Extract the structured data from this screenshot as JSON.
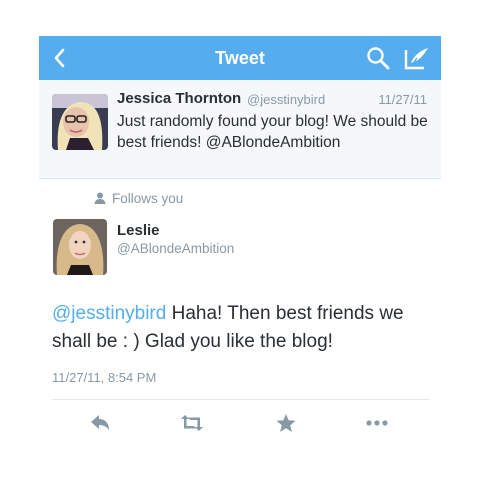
{
  "navbar": {
    "title": "Tweet",
    "back_icon": "chevron-left-icon",
    "search_icon": "search-icon",
    "compose_icon": "compose-icon",
    "background": "#55acee"
  },
  "reply_tweet": {
    "name": "Jessica Thornton",
    "handle": "@jesstinybird",
    "time": "11/27/11",
    "text": "Just randomly found your blog! We should be best friends! @ABlondeAmbition"
  },
  "follows_label": "Follows you",
  "main_tweet": {
    "name": "Leslie",
    "handle": "@ABlondeAmbition",
    "mention": "@jesstinybird",
    "body": " Haha! Then best friends we shall be : ) Glad you like the blog!",
    "timestamp": "11/27/11, 8:54 PM"
  },
  "actions": [
    "reply-icon",
    "retweet-icon",
    "favorite-icon",
    "more-icon"
  ],
  "colors": {
    "accent": "#55acee",
    "text": "#292f33",
    "secondary": "#8899a6",
    "icon": "#8899a6"
  }
}
